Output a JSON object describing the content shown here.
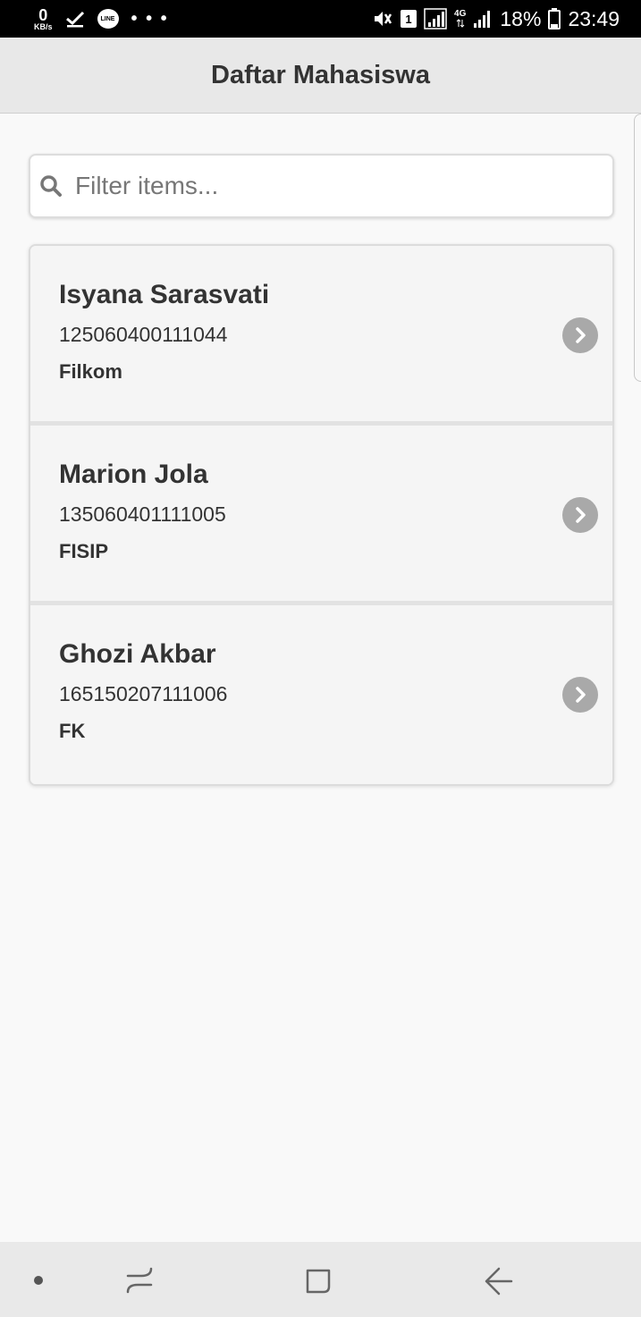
{
  "status_bar": {
    "data_speed_value": "0",
    "data_speed_unit": "KB/s",
    "line_label": "LINE",
    "more_dots": "• • •",
    "sim_slot": "1",
    "network_type": "4G",
    "battery_percent": "18%",
    "time": "23:49"
  },
  "header": {
    "title": "Daftar Mahasiswa"
  },
  "search": {
    "placeholder": "Filter items...",
    "value": ""
  },
  "students": [
    {
      "name": "Isyana Sarasvati",
      "nim": "125060400111044",
      "faculty": "Filkom"
    },
    {
      "name": "Marion Jola",
      "nim": "135060401111005",
      "faculty": "FISIP"
    },
    {
      "name": "Ghozi Akbar",
      "nim": "165150207111006",
      "faculty": "FK"
    }
  ],
  "icons": {
    "search": "search-icon",
    "item_chevron": "chevron-right-icon",
    "nav_recent": "recent-apps-icon",
    "nav_home": "home-icon",
    "nav_back": "back-icon"
  },
  "colors": {
    "header_bg": "#e8e8e8",
    "page_bg": "#f9f9f9",
    "chevron_bg": "#a9a9a9",
    "nav_bar_bg": "#e9e9e9"
  }
}
